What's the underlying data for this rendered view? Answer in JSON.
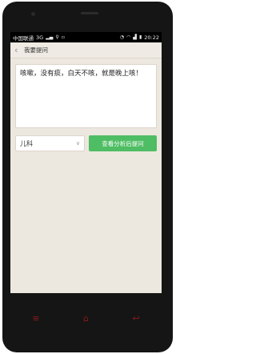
{
  "status_bar": {
    "carrier": "中国联通",
    "network": "3G",
    "time": "20:22"
  },
  "header": {
    "title": "我要提问"
  },
  "question": {
    "text": "咳嗽，没有痰，白天不咳，就是晚上咳！"
  },
  "department": {
    "selected": "儿科"
  },
  "submit": {
    "label": "查看分析后提问"
  },
  "colors": {
    "accent": "#4ebd63",
    "background": "#ece7df",
    "nav_keys": "#8b1a1a"
  },
  "icons": {
    "back": "chevron-left-icon",
    "dropdown": "chevron-down-icon",
    "nav_menu": "menu-icon",
    "nav_home": "home-icon",
    "nav_back": "back-icon"
  }
}
